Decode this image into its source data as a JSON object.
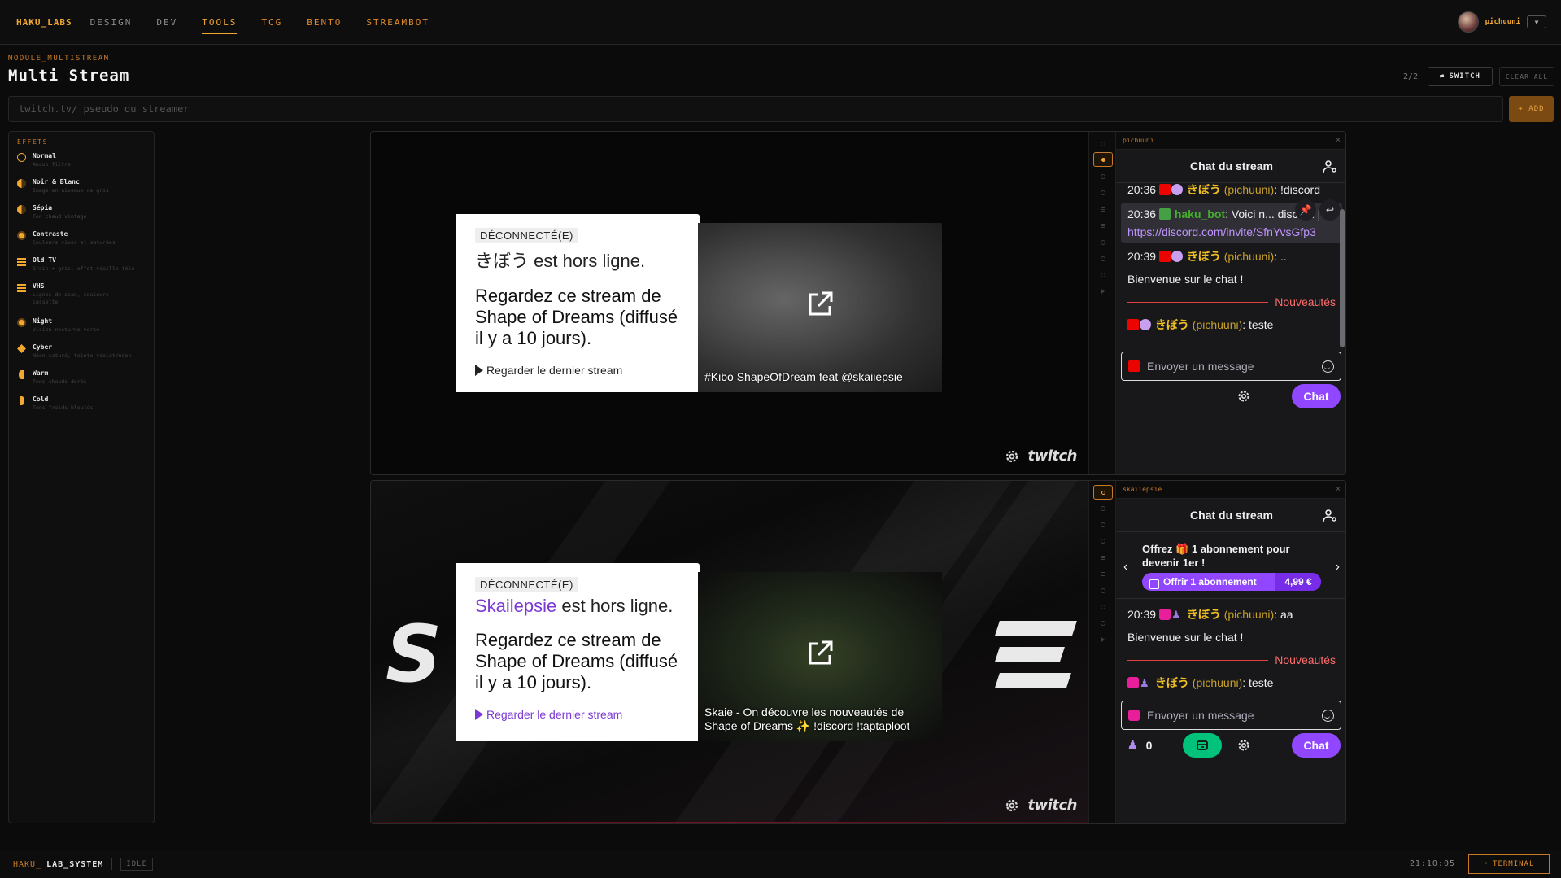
{
  "nav": {
    "brand": "HAKU_LABS",
    "links": [
      "DESIGN",
      "DEV",
      "TOOLS",
      "TCG",
      "BENTO",
      "STREAMBOT"
    ],
    "user": "pichuuni",
    "dropdown_glyph": "▼"
  },
  "header": {
    "module_label": "MODULE_MULTISTREAM",
    "title": "Multi Stream",
    "count": "2/2",
    "switch_label": "SWITCH",
    "clear_label": "CLEAR ALL",
    "input_placeholder": "twitch.tv/ pseudo du streamer",
    "add_label": "+ ADD"
  },
  "effects": {
    "heading": "EFFETS",
    "items": [
      {
        "name": "Normal",
        "desc": "Aucun filtre",
        "icon": "ring"
      },
      {
        "name": "Noir & Blanc",
        "desc": "Image en niveaux de gris",
        "icon": "half"
      },
      {
        "name": "Sépia",
        "desc": "Ton chaud vintage",
        "icon": "half"
      },
      {
        "name": "Contraste",
        "desc": "Couleurs vives et saturées",
        "icon": "dot"
      },
      {
        "name": "Old TV",
        "desc": "Grain + gris, effet vieille télé",
        "icon": "sq"
      },
      {
        "name": "VHS",
        "desc": "Lignes de scan, couleurs cassette",
        "icon": "sq"
      },
      {
        "name": "Night",
        "desc": "Vision nocturne verte",
        "icon": "dot"
      },
      {
        "name": "Cyber",
        "desc": "Néon saturé, teinte violet/néon",
        "icon": "dia"
      },
      {
        "name": "Warm",
        "desc": "Tons chauds dorés",
        "icon": "semil"
      },
      {
        "name": "Cold",
        "desc": "Tons froids bleutés",
        "icon": "semi"
      }
    ]
  },
  "streams": [
    {
      "channel": "pichuuni",
      "close": "×",
      "badge": "DÉCONNECTÉ(E)",
      "streamer_name": "きぼう",
      "offline_suffix": " est hors ligne.",
      "watch_text": "Regardez ce stream de Shape of Dreams (diffusé il y a 10 jours).",
      "last_stream": "Regarder le dernier stream",
      "thumb_caption": "#Kibo ShapeOfDream feat @skaiiepsie",
      "twitch_wordmark": "twitch",
      "chat": {
        "title": "Chat du stream",
        "messages": [
          {
            "time": "20:36",
            "user": "きぼう",
            "login": "(pichuuni)",
            "text": ": !discord"
          },
          {
            "time": "20:36",
            "user": "haku_bot",
            "text": ": Voici n... discord |",
            "link": "https://discord.com/invite/SfnYvsGfp3"
          },
          {
            "time": "20:39",
            "user": "きぼう",
            "login": "(pichuuni)",
            "text": ": .."
          },
          {
            "system": "Bienvenue sur le chat !"
          },
          {
            "separator": "Nouveautés"
          },
          {
            "user": "きぼう",
            "login": "(pichuuni)",
            "text": ": teste"
          }
        ],
        "input_placeholder": "Envoyer un message",
        "send_label": "Chat"
      }
    },
    {
      "channel": "skaiiepsie",
      "close": "×",
      "badge": "DÉCONNECTÉ(E)",
      "streamer_name": "Skailepsie",
      "offline_suffix": " est hors ligne.",
      "watch_text": "Regardez ce stream de Shape of Dreams (diffusé il y a 10 jours).",
      "last_stream": "Regarder le dernier stream",
      "thumb_caption": "Skaie - On découvre les nouveautés de Shape of Dreams ✨ !discord !taptaploot",
      "twitch_wordmark": "twitch",
      "chat": {
        "title": "Chat du stream",
        "promo": "Offrez 🎁 1 abonnement pour devenir 1er !",
        "gift_label": "Offrir 1 abonnement",
        "gift_price": "4,99 €",
        "messages": [
          {
            "time": "20:39",
            "user": "きぼう",
            "login": "(pichuuni)",
            "text": ": aa"
          },
          {
            "system": "Bienvenue sur le chat !"
          },
          {
            "separator": "Nouveautés"
          },
          {
            "user": "きぼう",
            "login": "(pichuuni)",
            "text": ": teste"
          }
        ],
        "input_placeholder": "Envoyer un message",
        "points": "0",
        "send_label": "Chat"
      }
    }
  ],
  "status": {
    "sys_prefix": "HAKU_",
    "sys_name": "LAB_SYSTEM",
    "state": "IDLE",
    "clock": "21:10:05",
    "terminal_label": "TERMINAL"
  },
  "colors": {
    "accent": "#f0a830",
    "twitch_purple": "#9147ff",
    "chat_bg": "#18181b"
  }
}
